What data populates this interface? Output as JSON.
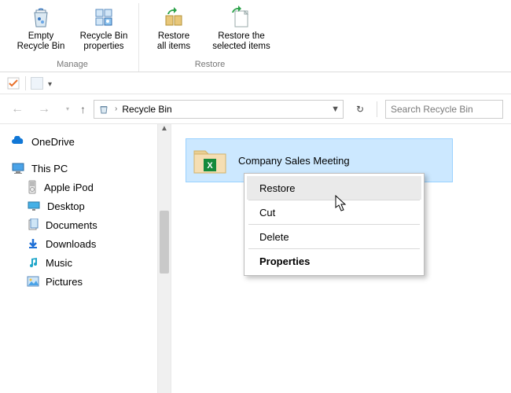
{
  "ribbon": {
    "empty": "Empty\nRecycle Bin",
    "props": "Recycle Bin\nproperties",
    "restore_all": "Restore\nall items",
    "restore_sel": "Restore the\nselected items",
    "group_manage": "Manage",
    "group_restore": "Restore"
  },
  "address": {
    "location": "Recycle Bin",
    "search_placeholder": "Search Recycle Bin"
  },
  "tree": {
    "onedrive": "OneDrive",
    "thispc": "This PC",
    "ipod": "Apple iPod",
    "desktop": "Desktop",
    "documents": "Documents",
    "downloads": "Downloads",
    "music": "Music",
    "pictures": "Pictures"
  },
  "file": {
    "name": "Company Sales Meeting"
  },
  "ctx": {
    "restore": "Restore",
    "cut": "Cut",
    "delete": "Delete",
    "properties": "Properties"
  }
}
